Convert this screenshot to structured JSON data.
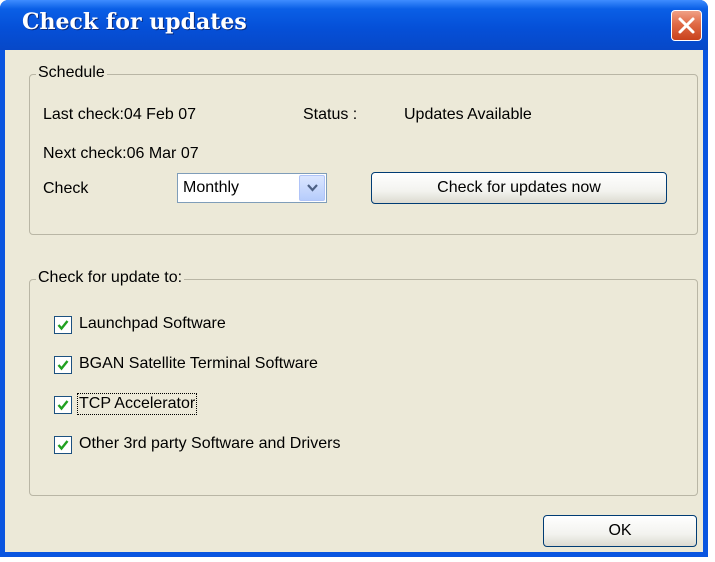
{
  "window": {
    "title": "Check for updates"
  },
  "schedule": {
    "legend": "Schedule",
    "last_check": "Last check:04 Feb 07",
    "status_label": "Status :",
    "status_value": "Updates Available",
    "next_check": "Next check:06 Mar 07",
    "check_label": "Check",
    "frequency": "Monthly",
    "check_now_button": "Check for updates now"
  },
  "update_targets": {
    "legend": "Check for update to:",
    "items": [
      {
        "label": "Launchpad Software",
        "checked": true
      },
      {
        "label": "BGAN Satellite Terminal Software",
        "checked": true
      },
      {
        "label": "TCP Accelerator",
        "checked": true,
        "focused": true
      },
      {
        "label": "Other 3rd party Software and Drivers",
        "checked": true
      }
    ]
  },
  "footer": {
    "ok_button": "OK"
  },
  "colors": {
    "titlebar": "#0550d8",
    "dialog_bg": "#ece9d8",
    "check_mark": "#21a121",
    "close_button": "#e06a45"
  }
}
